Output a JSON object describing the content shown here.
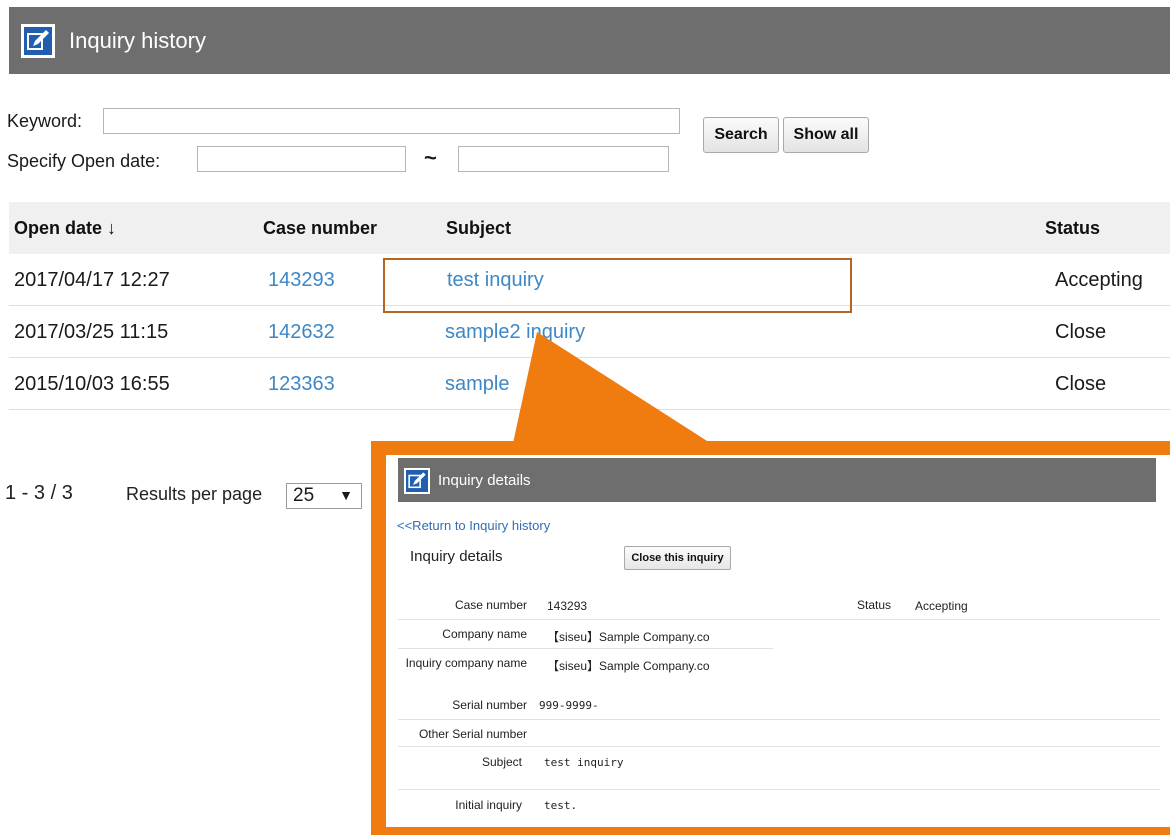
{
  "header": {
    "title": "Inquiry history",
    "icon": "edit-icon"
  },
  "search": {
    "keyword_label": "Keyword:",
    "keyword_value": "",
    "open_date_label": "Specify Open date:",
    "date_from": "",
    "date_to": "",
    "range_separator": "~",
    "search_label": "Search",
    "show_all_label": "Show all"
  },
  "table": {
    "columns": [
      "Open date ↓",
      "Case number",
      "Subject",
      "Status"
    ],
    "rows": [
      {
        "open_date": "2017/04/17 12:27",
        "case_number": "143293",
        "subject": "test inquiry",
        "status": "Accepting"
      },
      {
        "open_date": "2017/03/25 11:15",
        "case_number": "142632",
        "subject": "sample2 inquiry",
        "status": "Close"
      },
      {
        "open_date": "2015/10/03 16:55",
        "case_number": "123363",
        "subject": "sample",
        "status": "Close"
      }
    ]
  },
  "pagination": {
    "range": "1 -  3 / 3",
    "per_page_label": "Results per page",
    "per_page_value": "25",
    "dropdown_arrow": "▼"
  },
  "details": {
    "header_title": "Inquiry details",
    "back_link": "<<Return to Inquiry history",
    "section_title": "Inquiry details",
    "close_button": "Close this inquiry",
    "fields": {
      "case_number_label": "Case number",
      "case_number": "143293",
      "status_label": "Status",
      "status": "Accepting",
      "company_name_label": "Company name",
      "company_name": "【siseu】Sample Company.co",
      "inquiry_company_label": "Inquiry company name",
      "inquiry_company": "【siseu】Sample Company.co",
      "serial_label": "Serial number",
      "serial": "999-9999-",
      "other_serial_label": "Other Serial number",
      "other_serial": "",
      "subject_label": "Subject",
      "subject": "test inquiry",
      "initial_label": "Initial inquiry",
      "initial": "test."
    }
  },
  "colors": {
    "header_bg": "#6e6e6e",
    "link": "#3d87c6",
    "callout": "#f07b0f",
    "highlight_border": "#b3661e"
  }
}
